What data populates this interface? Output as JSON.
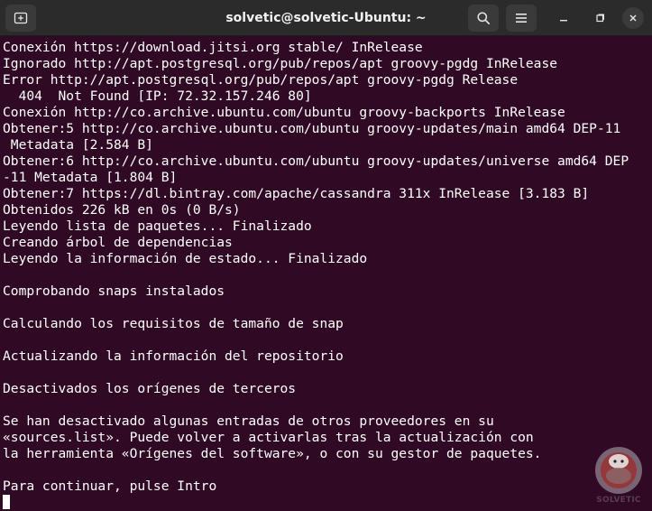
{
  "window": {
    "title": "solvetic@solvetic-Ubuntu: ~"
  },
  "icons": {
    "new_tab": "new-tab-icon",
    "search": "search-icon",
    "menu": "hamburger-menu-icon",
    "minimize": "minimize-icon",
    "maximize": "maximize-icon",
    "close": "close-icon"
  },
  "colors": {
    "terminal_background": "#300a24",
    "text": "#ffffff",
    "titlebar": "#2b2b2b"
  },
  "terminal": {
    "lines": [
      "Conexión https://download.jitsi.org stable/ InRelease",
      "Ignorado http://apt.postgresql.org/pub/repos/apt groovy-pgdg InRelease",
      "Error http://apt.postgresql.org/pub/repos/apt groovy-pgdg Release",
      "  404  Not Found [IP: 72.32.157.246 80]",
      "Conexión http://co.archive.ubuntu.com/ubuntu groovy-backports InRelease",
      "Obtener:5 http://co.archive.ubuntu.com/ubuntu groovy-updates/main amd64 DEP-11",
      " Metadata [2.584 B]",
      "Obtener:6 http://co.archive.ubuntu.com/ubuntu groovy-updates/universe amd64 DEP",
      "-11 Metadata [1.804 B]",
      "Obtener:7 https://dl.bintray.com/apache/cassandra 311x InRelease [3.183 B]",
      "Obtenidos 226 kB en 0s (0 B/s)",
      "Leyendo lista de paquetes... Finalizado",
      "Creando árbol de dependencias",
      "Leyendo la información de estado... Finalizado",
      "",
      "Comprobando snaps instalados",
      "",
      "Calculando los requisitos de tamaño de snap",
      "",
      "Actualizando la información del repositorio",
      "",
      "Desactivados los orígenes de terceros",
      "",
      "Se han desactivado algunas entradas de otros proveedores en su",
      "«sources.list». Puede volver a activarlas tras la actualización con",
      "la herramienta «Orígenes del software», o con su gestor de paquetes.",
      "",
      "Para continuar, pulse Intro"
    ]
  },
  "watermark": {
    "text": "SOLVETIC"
  }
}
